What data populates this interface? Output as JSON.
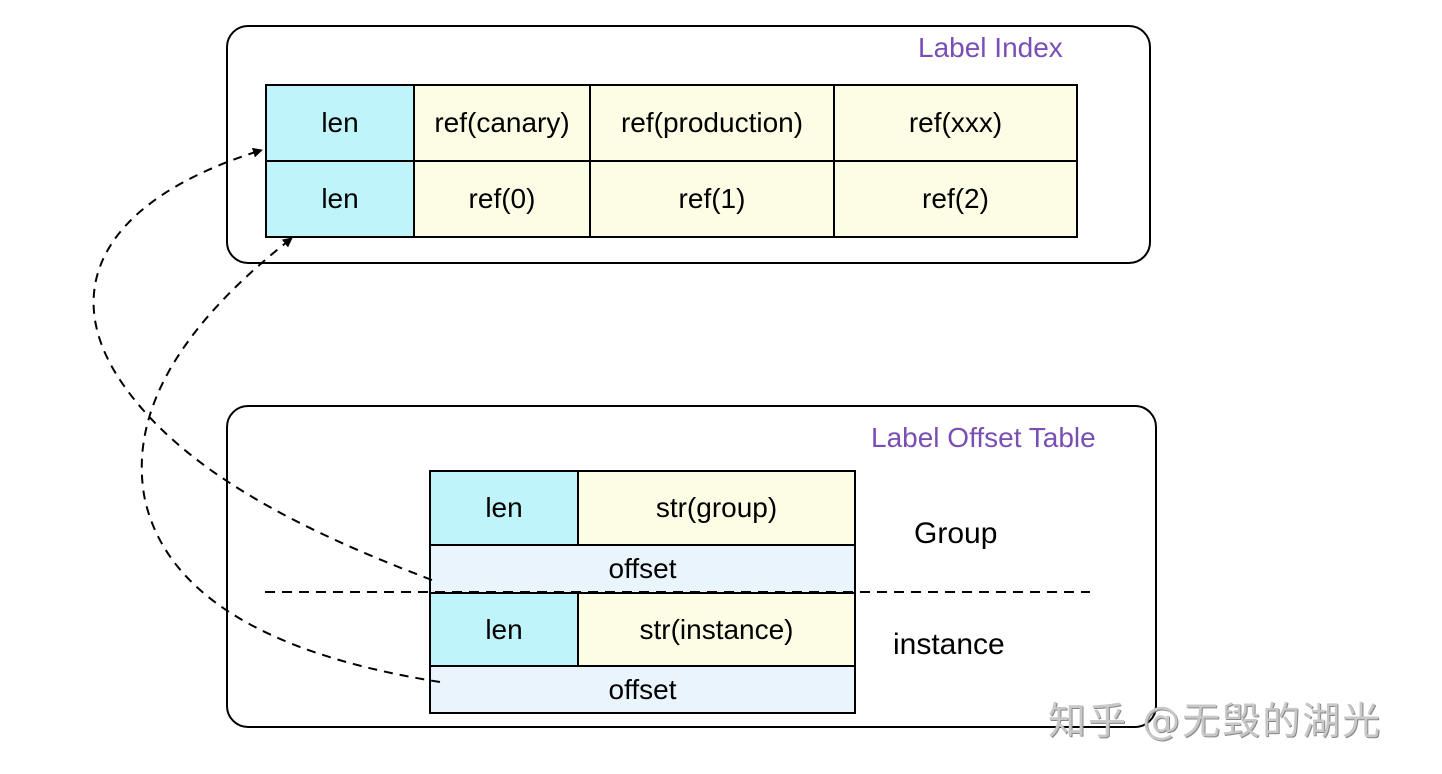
{
  "label_index": {
    "title": "Label Index",
    "rows": [
      [
        "len",
        "ref(canary)",
        "ref(production)",
        "ref(xxx)"
      ],
      [
        "len",
        "ref(0)",
        "ref(1)",
        "ref(2)"
      ]
    ]
  },
  "label_offset_table": {
    "title": "Label Offset Table",
    "entries": [
      {
        "len": "len",
        "str": "str(group)",
        "offset": "offset",
        "label": "Group"
      },
      {
        "len": "len",
        "str": "str(instance)",
        "offset": "offset",
        "label": "instance"
      }
    ]
  },
  "arrows": [
    {
      "from": "label_offset_table.entries.0.offset",
      "to": "label_index.rows.0.0",
      "style": "dashed"
    },
    {
      "from": "label_offset_table.entries.1.offset",
      "to": "label_index.rows.1.0",
      "style": "dashed"
    }
  ],
  "colors": {
    "title": "#7a4fb5",
    "len_cell": "#bff4fb",
    "ref_cell": "#fdfde6",
    "offset_cell": "#eaf4fd"
  },
  "watermark": "知乎 @无毁的湖光"
}
